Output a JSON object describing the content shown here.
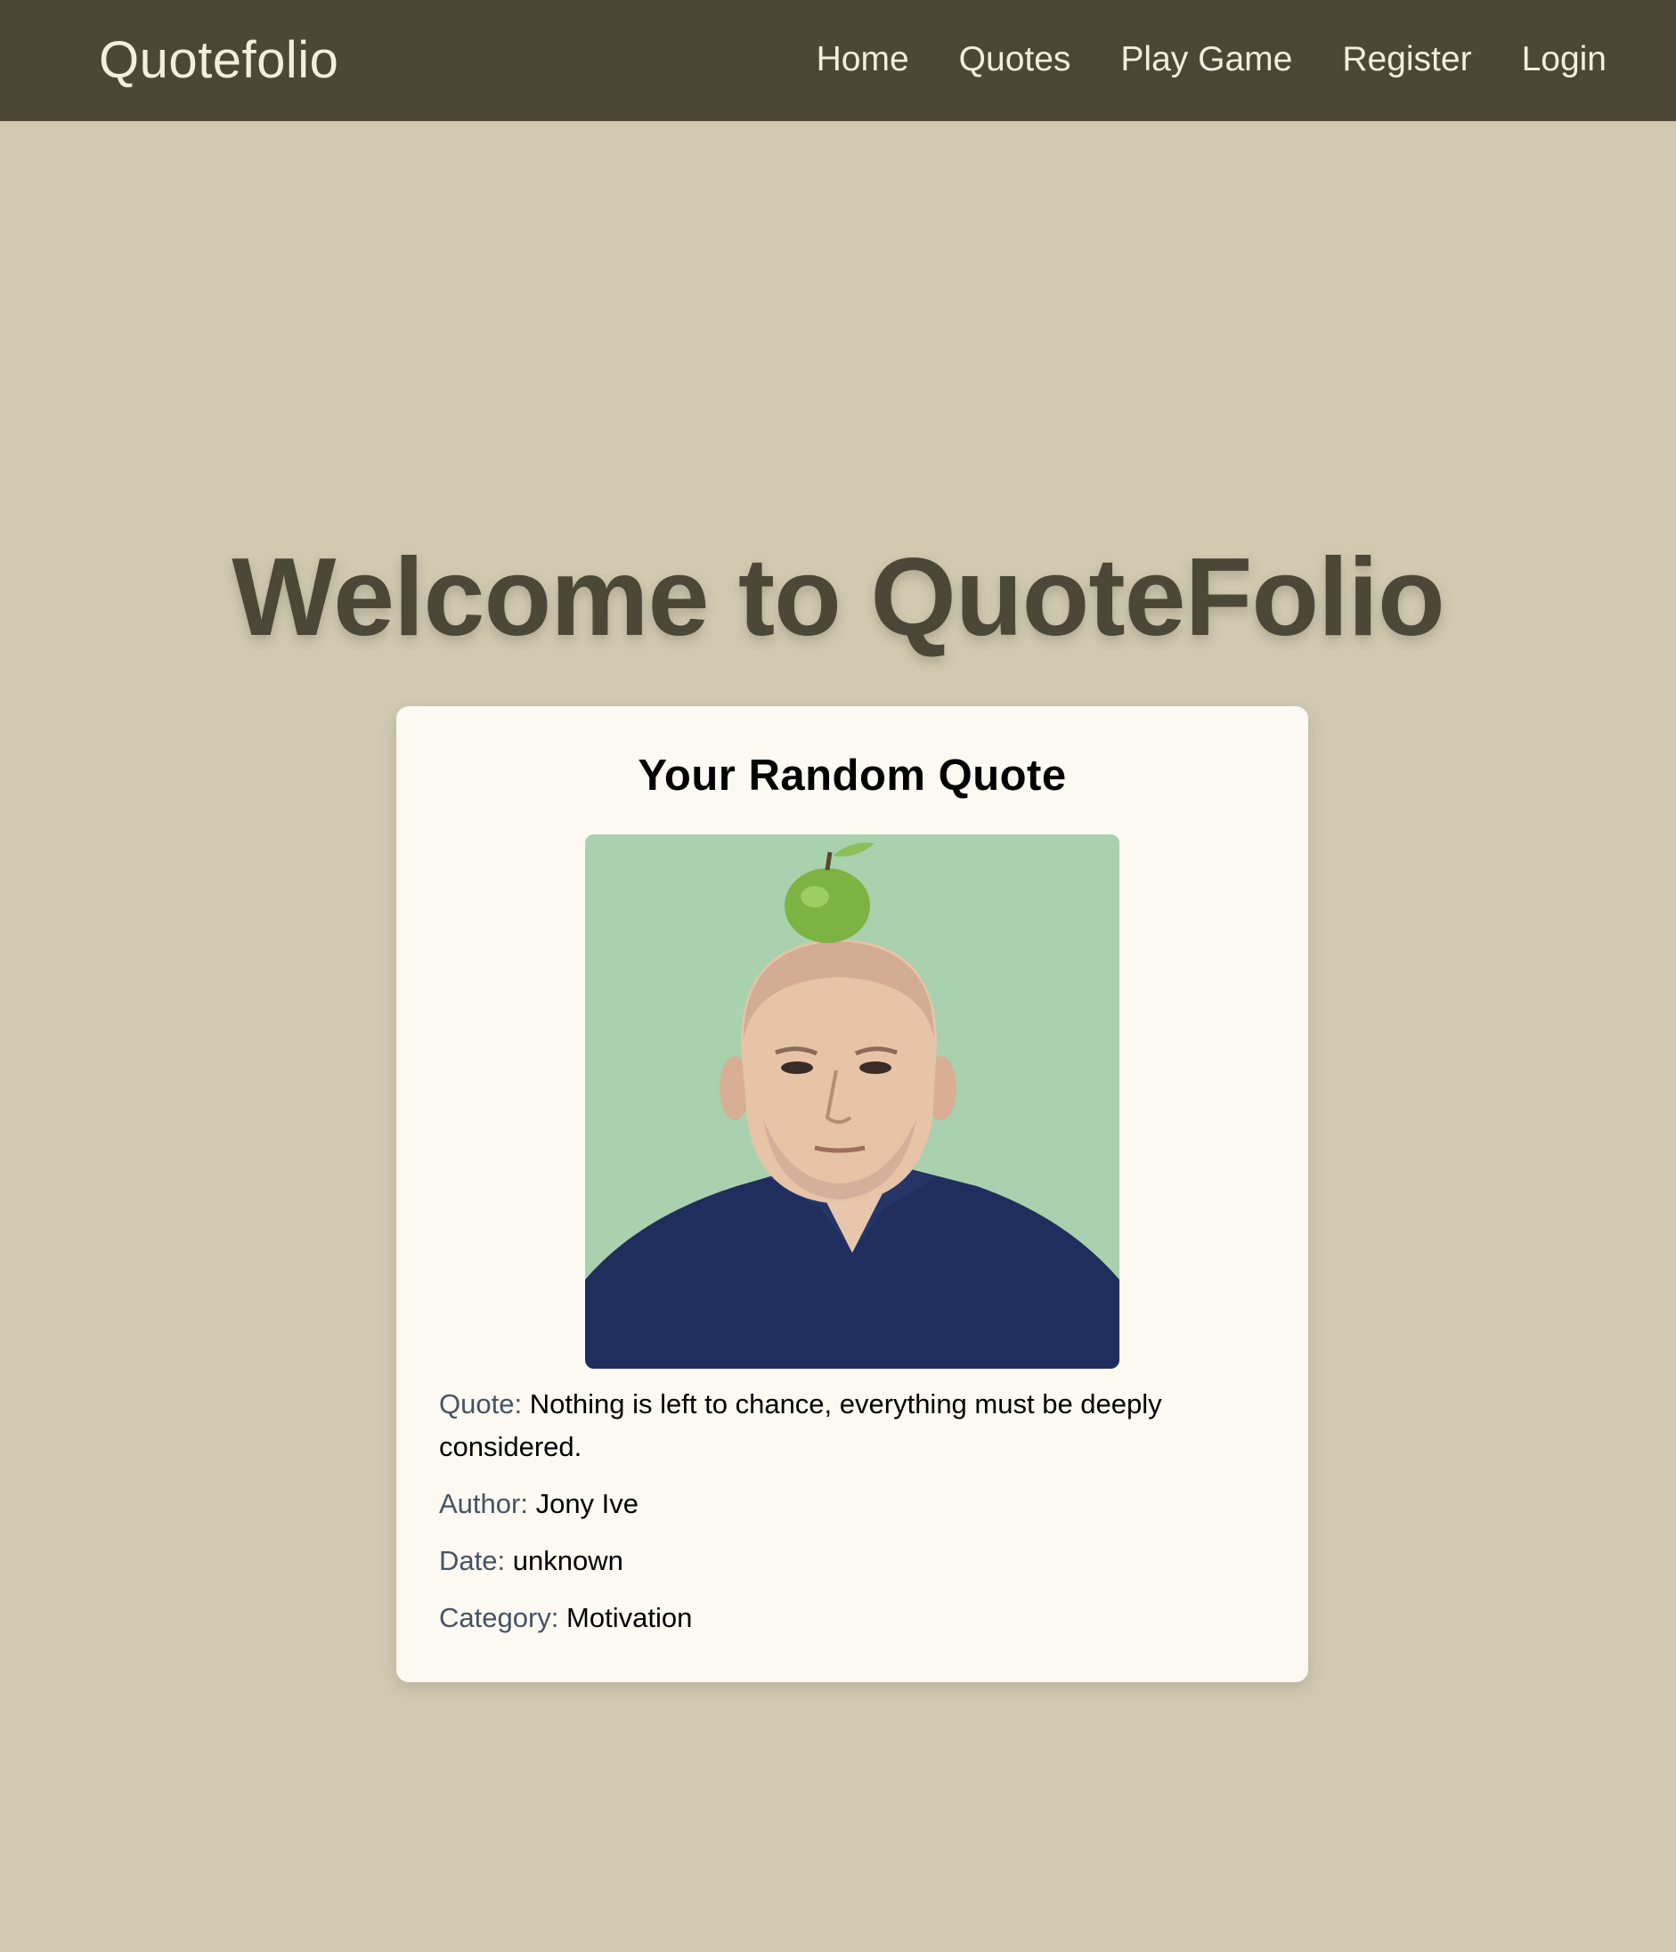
{
  "navbar": {
    "brand": "Quotefolio",
    "links": [
      "Home",
      "Quotes",
      "Play Game",
      "Register",
      "Login"
    ]
  },
  "hero": {
    "title": "Welcome to QuoteFolio"
  },
  "card": {
    "title": "Your Random Quote",
    "image_icon": "author-portrait-image",
    "quote_label": "Quote:",
    "quote_text": "Nothing is left to chance, everything must be deeply considered.",
    "author_label": "Author:",
    "author_value": "Jony Ive",
    "date_label": "Date:",
    "date_value": "unknown",
    "category_label": "Category:",
    "category_value": "Motivation"
  },
  "colors": {
    "page_background": "#d1cab1",
    "navbar_background": "#4c4838",
    "navbar_text": "#f3efdc",
    "hero_text": "#4c4838",
    "card_background": "#fbf9f2",
    "label_text": "#475263"
  }
}
